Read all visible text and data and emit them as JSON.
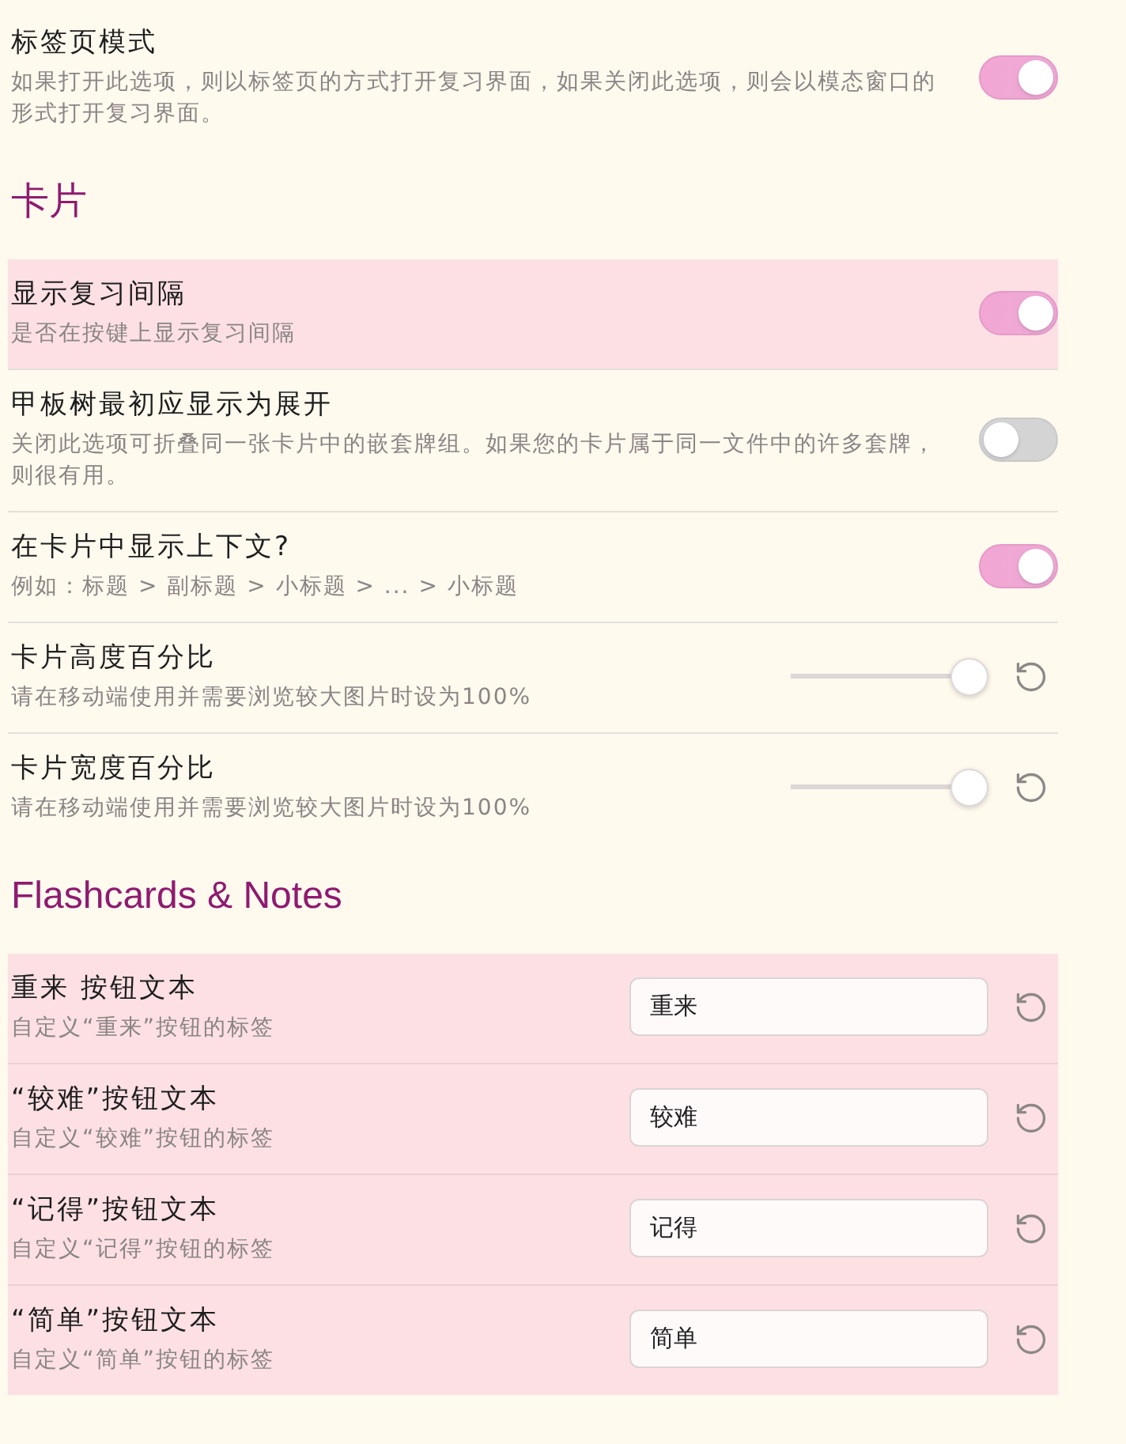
{
  "sections": [
    {
      "rows": [
        {
          "kind": "toggle",
          "title": "标签页模式",
          "description": "如果打开此选项，则以标签页的方式打开复习界面，如果关闭此选项，则会以模态窗口的形式打开复习界面。",
          "on": true,
          "highlighted": false
        }
      ]
    },
    {
      "heading": "卡片",
      "rows": [
        {
          "kind": "toggle",
          "title": "显示复习间隔",
          "description": "是否在按键上显示复习间隔",
          "on": true,
          "highlighted": true
        },
        {
          "kind": "toggle",
          "title": "甲板树最初应显示为展开",
          "description": "关闭此选项可折叠同一张卡片中的嵌套牌组。如果您的卡片属于同一文件中的许多套牌，则很有用。",
          "on": false,
          "highlighted": false
        },
        {
          "kind": "toggle",
          "title": "在卡片中显示上下文?",
          "description": "例如：标题 > 副标题 > 小标题 > ... > 小标题",
          "on": true,
          "highlighted": false
        },
        {
          "kind": "slider",
          "title": "卡片高度百分比",
          "description": "请在移动端使用并需要浏览较大图片时设为100%",
          "level": 1,
          "highlighted": false
        },
        {
          "kind": "slider",
          "title": "卡片宽度百分比",
          "description": "请在移动端使用并需要浏览较大图片时设为100%",
          "level": 1,
          "highlighted": false
        }
      ]
    },
    {
      "heading": "Flashcards & Notes",
      "rows": [
        {
          "kind": "text",
          "title": "重来 按钮文本",
          "description": "自定义“重来”按钮的标签",
          "value": "重来",
          "highlighted": true
        },
        {
          "kind": "text",
          "title": "“较难”按钮文本",
          "description": "自定义“较难”按钮的标签",
          "value": "较难",
          "highlighted": true
        },
        {
          "kind": "text",
          "title": "“记得”按钮文本",
          "description": "自定义“记得”按钮的标签",
          "value": "记得",
          "highlighted": true
        },
        {
          "kind": "text",
          "title": "“简单”按钮文本",
          "description": "自定义“简单”按钮的标签",
          "value": "简单",
          "highlighted": true
        }
      ]
    }
  ]
}
